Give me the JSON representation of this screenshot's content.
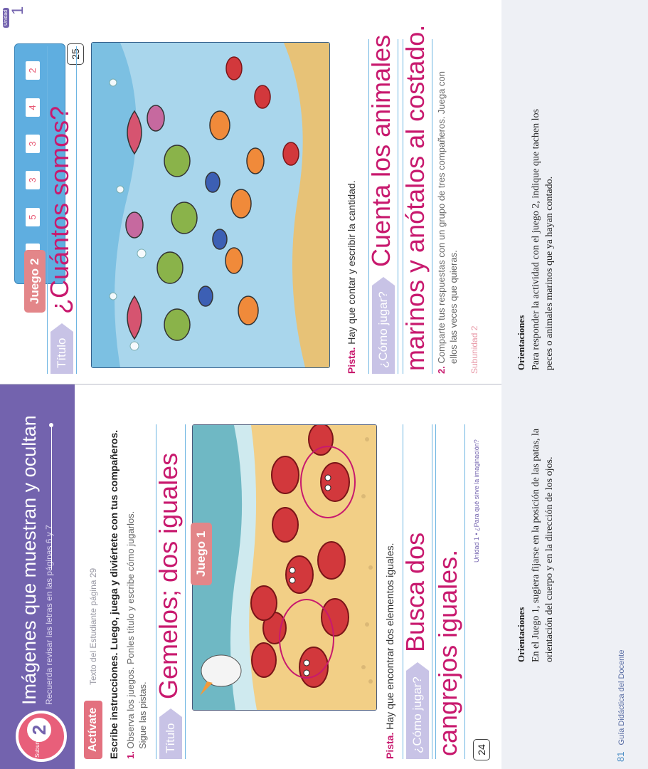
{
  "left_page": {
    "subunit_word": "Subunidad",
    "subunit_number": "2",
    "unit_title": "Imágenes que muestran y ocultan",
    "unit_subtitle": "Recuerda revisar las letras en las páginas 6 y 7",
    "activate_label": "Actívate",
    "student_text_ref": "Texto del Estudiante página 29",
    "instruction": "Escribe instrucciones. Luego, juega y diviértete con tus compañeros.",
    "step_number": "1.",
    "step_text_line1": "Observa los juegos. Ponles título y escribe cómo jugarlos.",
    "step_text_line2": "Sigue las pistas.",
    "title_label": "Título",
    "title_written": "Gemelos; dos iguales",
    "game_tag": "Juego 1",
    "hint_label": "Pista.",
    "hint_text": "Hay que encontrar dos elementos iguales.",
    "how_label": "¿Cómo jugar?",
    "how_written_line1": "Busca dos",
    "how_written_line2": "cangrejos iguales.",
    "footer_unit": "Unidad 1 • ¿Para qué sirve la imaginación?",
    "page_number": "24"
  },
  "right_page": {
    "unit_corner_word": "Unidad",
    "unit_corner_number": "1",
    "game_tag": "Juego 2",
    "count_boxes": [
      "4",
      "5",
      "3",
      "3",
      "4",
      "2"
    ],
    "page_number": "25",
    "title_label": "Título",
    "title_written": "¿Cuántos somos?",
    "hint_label": "Pista.",
    "hint_text": "Hay que contar y escribir la cantidad.",
    "how_label": "¿Cómo jugar?",
    "how_written_line1": "Cuenta los animales",
    "how_written_line2": "marinos y anótalos al costado.",
    "step_number": "2.",
    "step_text_line1": "Comparte tus respuestas con un grupo de tres compañeros. Juega con",
    "step_text_line2": "ellos las veces que quieras.",
    "footer_subunit": "Subunidad 2"
  },
  "guide_notes": {
    "left_heading": "Orientaciones",
    "left_text": "En el Juego 1, sugiera fijarse en la posición de las patas, la orientación del cuerpo y en la dirección de los ojos.",
    "right_heading": "Orientaciones",
    "right_text": "Para responder la actividad con el juego 2, indique que tachen los peces o animales marinos que ya hayan contado.",
    "guide_page_number": "81",
    "guide_label": "Guía Didáctica del Docente"
  },
  "colors": {
    "purple_band": "#7363ae",
    "magenta_handwriting": "#c8196e",
    "coral": "#e3717f",
    "sky_blue": "#6db5e2"
  }
}
